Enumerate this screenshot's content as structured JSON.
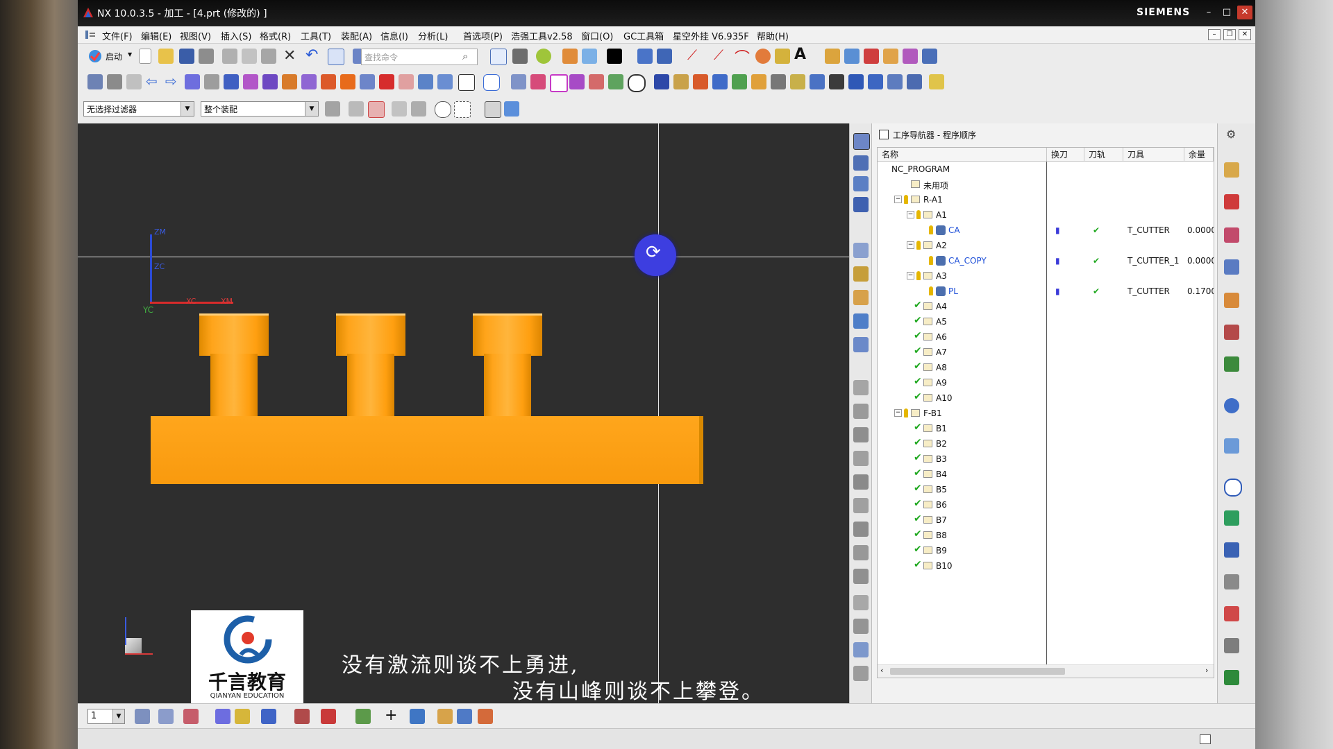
{
  "window": {
    "title": "NX 10.0.3.5 - 加工 - [4.prt  (修改的) ]",
    "brand": "SIEMENS",
    "minimize": "–",
    "maximize": "□",
    "close": "✕"
  },
  "menu": [
    "文件(F)",
    "编辑(E)",
    "视图(V)",
    "插入(S)",
    "格式(R)",
    "工具(T)",
    "装配(A)",
    "信息(I)",
    "分析(L)",
    "首选项(P)",
    "浩强工具v2.58",
    "窗口(O)",
    "GC工具箱",
    "星空外挂 V6.935F",
    "帮助(H)"
  ],
  "toolbar": {
    "start_label": "启动",
    "search_placeholder": "查找命令"
  },
  "filters": {
    "selection_filter": "无选择过滤器",
    "scope": "整个装配"
  },
  "viewport": {
    "axis_labels": {
      "zm": "ZM",
      "zc": "ZC",
      "yc": "YC",
      "xc": "XC",
      "xm": "XM"
    }
  },
  "subtitles": {
    "line1": "没有激流则谈不上勇进,",
    "line2": "没有山峰则谈不上攀登。"
  },
  "logo": {
    "name": "千言教育",
    "english": "QIANYAN EDUCATION"
  },
  "navigator": {
    "title": "工序导航器 - 程序顺序",
    "columns": [
      "名称",
      "换刀",
      "刀轨",
      "刀具",
      "余量"
    ],
    "rows": [
      {
        "name": "NC_PROGRAM",
        "level": 0,
        "type": "root",
        "toggle": "",
        "key": false,
        "check": false,
        "change": "",
        "path": "",
        "tool": "",
        "stock": ""
      },
      {
        "name": "未用项",
        "level": 1,
        "type": "folder",
        "toggle": "",
        "key": false,
        "check": false,
        "change": "",
        "path": "",
        "tool": "",
        "stock": ""
      },
      {
        "name": "R-A1",
        "level": 1,
        "type": "folder",
        "toggle": "−",
        "key": true,
        "check": false,
        "change": "",
        "path": "",
        "tool": "",
        "stock": ""
      },
      {
        "name": "A1",
        "level": 2,
        "type": "folder",
        "toggle": "−",
        "key": true,
        "check": false,
        "change": "",
        "path": "",
        "tool": "",
        "stock": ""
      },
      {
        "name": "CA",
        "level": 3,
        "type": "op",
        "toggle": "",
        "key": true,
        "check": false,
        "change": "▮",
        "path": "✔",
        "tool": "T_CUTTER",
        "stock": "0.0000"
      },
      {
        "name": "A2",
        "level": 2,
        "type": "folder",
        "toggle": "−",
        "key": true,
        "check": false,
        "change": "",
        "path": "",
        "tool": "",
        "stock": ""
      },
      {
        "name": "CA_COPY",
        "level": 3,
        "type": "op",
        "toggle": "",
        "key": true,
        "check": false,
        "change": "▮",
        "path": "✔",
        "tool": "T_CUTTER_1",
        "stock": "0.0000"
      },
      {
        "name": "A3",
        "level": 2,
        "type": "folder",
        "toggle": "−",
        "key": true,
        "check": false,
        "change": "",
        "path": "",
        "tool": "",
        "stock": ""
      },
      {
        "name": "PL",
        "level": 3,
        "type": "op",
        "toggle": "",
        "key": true,
        "check": false,
        "change": "▮",
        "path": "✔",
        "tool": "T_CUTTER",
        "stock": "0.1700"
      },
      {
        "name": "A4",
        "level": 2,
        "type": "folder",
        "toggle": "",
        "key": false,
        "check": true,
        "change": "",
        "path": "",
        "tool": "",
        "stock": ""
      },
      {
        "name": "A5",
        "level": 2,
        "type": "folder",
        "toggle": "",
        "key": false,
        "check": true,
        "change": "",
        "path": "",
        "tool": "",
        "stock": ""
      },
      {
        "name": "A6",
        "level": 2,
        "type": "folder",
        "toggle": "",
        "key": false,
        "check": true,
        "change": "",
        "path": "",
        "tool": "",
        "stock": ""
      },
      {
        "name": "A7",
        "level": 2,
        "type": "folder",
        "toggle": "",
        "key": false,
        "check": true,
        "change": "",
        "path": "",
        "tool": "",
        "stock": ""
      },
      {
        "name": "A8",
        "level": 2,
        "type": "folder",
        "toggle": "",
        "key": false,
        "check": true,
        "change": "",
        "path": "",
        "tool": "",
        "stock": ""
      },
      {
        "name": "A9",
        "level": 2,
        "type": "folder",
        "toggle": "",
        "key": false,
        "check": true,
        "change": "",
        "path": "",
        "tool": "",
        "stock": ""
      },
      {
        "name": "A10",
        "level": 2,
        "type": "folder",
        "toggle": "",
        "key": false,
        "check": true,
        "change": "",
        "path": "",
        "tool": "",
        "stock": ""
      },
      {
        "name": "F-B1",
        "level": 1,
        "type": "folder",
        "toggle": "−",
        "key": true,
        "check": false,
        "change": "",
        "path": "",
        "tool": "",
        "stock": ""
      },
      {
        "name": "B1",
        "level": 2,
        "type": "folder",
        "toggle": "",
        "key": false,
        "check": true,
        "change": "",
        "path": "",
        "tool": "",
        "stock": ""
      },
      {
        "name": "B2",
        "level": 2,
        "type": "folder",
        "toggle": "",
        "key": false,
        "check": true,
        "change": "",
        "path": "",
        "tool": "",
        "stock": ""
      },
      {
        "name": "B3",
        "level": 2,
        "type": "folder",
        "toggle": "",
        "key": false,
        "check": true,
        "change": "",
        "path": "",
        "tool": "",
        "stock": ""
      },
      {
        "name": "B4",
        "level": 2,
        "type": "folder",
        "toggle": "",
        "key": false,
        "check": true,
        "change": "",
        "path": "",
        "tool": "",
        "stock": ""
      },
      {
        "name": "B5",
        "level": 2,
        "type": "folder",
        "toggle": "",
        "key": false,
        "check": true,
        "change": "",
        "path": "",
        "tool": "",
        "stock": ""
      },
      {
        "name": "B6",
        "level": 2,
        "type": "folder",
        "toggle": "",
        "key": false,
        "check": true,
        "change": "",
        "path": "",
        "tool": "",
        "stock": ""
      },
      {
        "name": "B7",
        "level": 2,
        "type": "folder",
        "toggle": "",
        "key": false,
        "check": true,
        "change": "",
        "path": "",
        "tool": "",
        "stock": ""
      },
      {
        "name": "B8",
        "level": 2,
        "type": "folder",
        "toggle": "",
        "key": false,
        "check": true,
        "change": "",
        "path": "",
        "tool": "",
        "stock": ""
      },
      {
        "name": "B9",
        "level": 2,
        "type": "folder",
        "toggle": "",
        "key": false,
        "check": true,
        "change": "",
        "path": "",
        "tool": "",
        "stock": ""
      },
      {
        "name": "B10",
        "level": 2,
        "type": "folder",
        "toggle": "",
        "key": false,
        "check": true,
        "change": "",
        "path": "",
        "tool": "",
        "stock": ""
      }
    ]
  },
  "bottombar": {
    "layer_value": "1"
  },
  "colors": {
    "part": "#ffa41a",
    "viewport_bg": "#2e2e2e",
    "rotate_badge": "#3d3ee0",
    "check": "#1fa81f",
    "op_link": "#1e4fd8"
  }
}
